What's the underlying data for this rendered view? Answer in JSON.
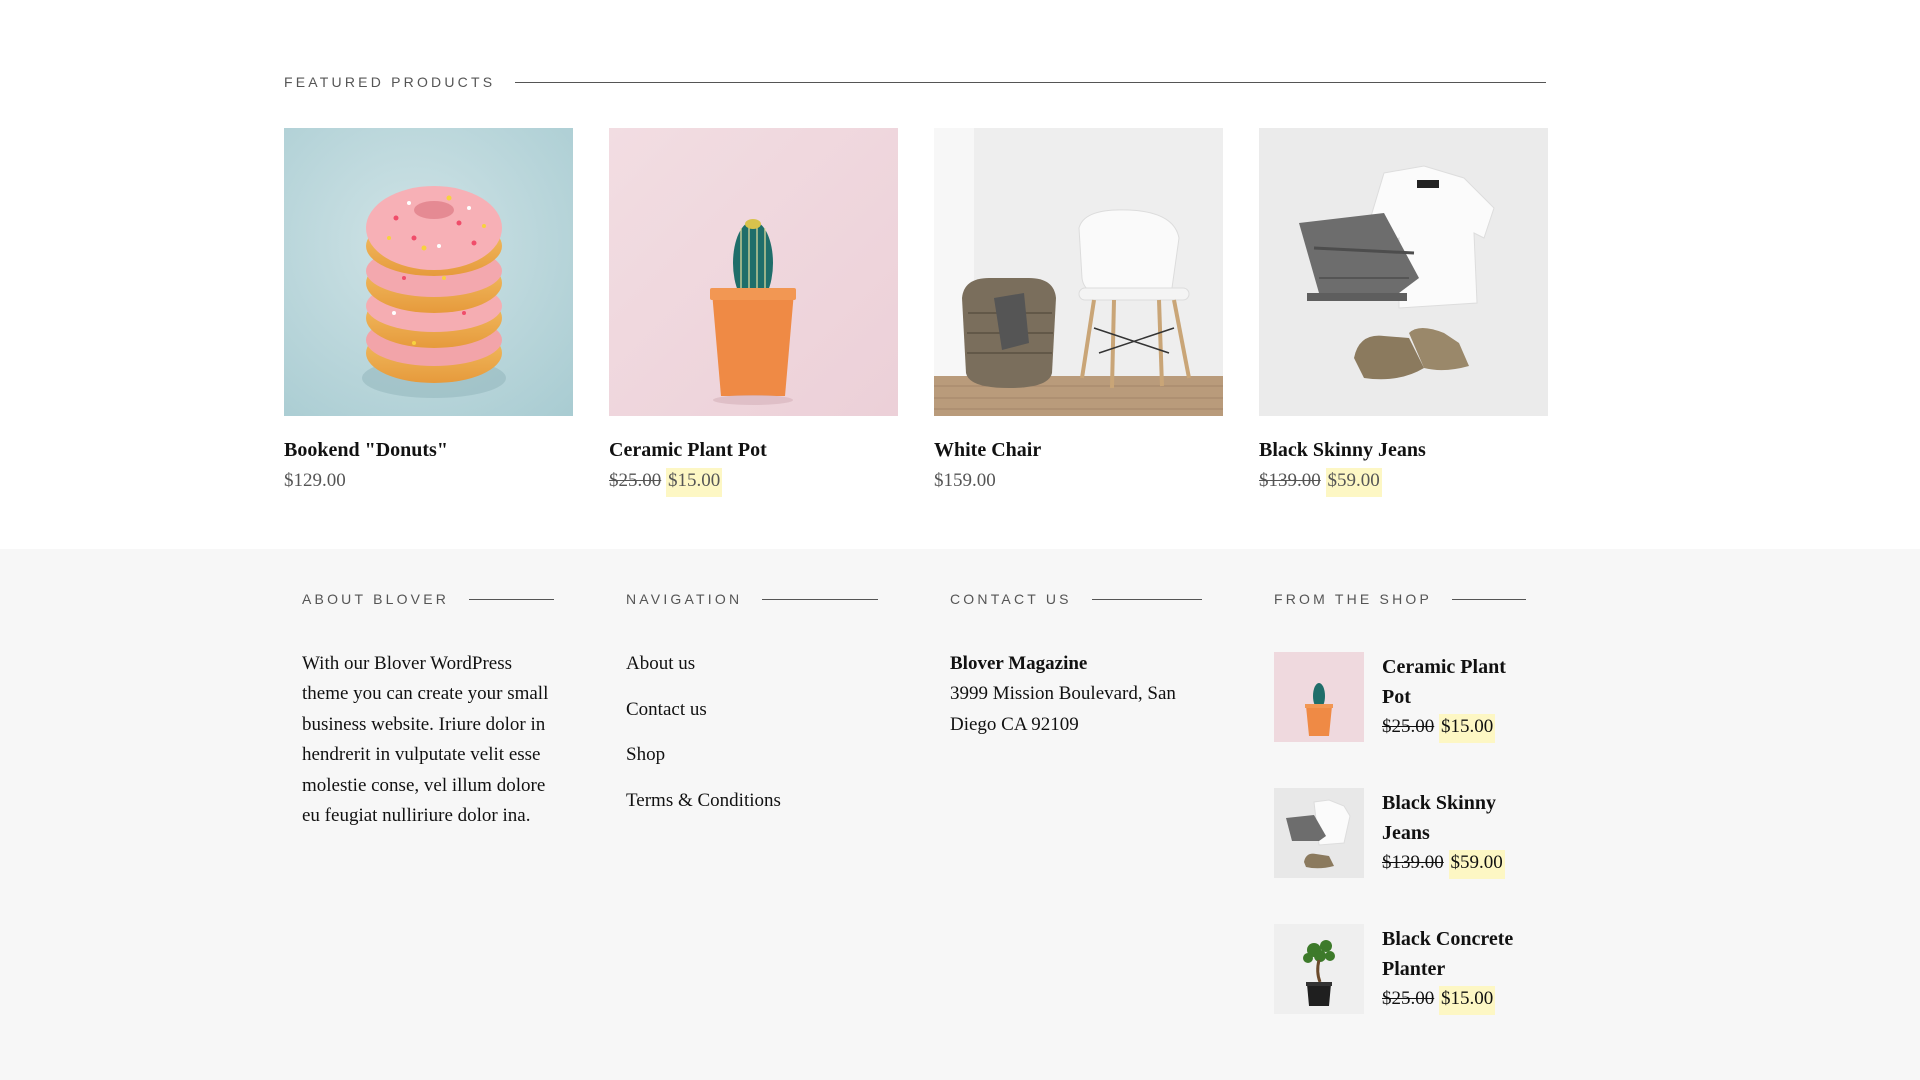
{
  "featured": {
    "heading": "FEATURED PRODUCTS",
    "products": [
      {
        "name": "Bookend \"Donuts\"",
        "price": "$129.00",
        "image": "donuts-stack"
      },
      {
        "name": "Ceramic Plant Pot",
        "old_price": "$25.00",
        "sale_price": "$15.00",
        "image": "cactus-pot"
      },
      {
        "name": "White Chair",
        "price": "$159.00",
        "image": "white-chair-basket"
      },
      {
        "name": "Black Skinny Jeans",
        "old_price": "$139.00",
        "sale_price": "$59.00",
        "image": "clothes-flatlay"
      }
    ]
  },
  "footer": {
    "about": {
      "heading": "ABOUT BLOVER",
      "text": "With our Blover WordPress theme you can create your small business website. Iriure dolor in hendrerit in vulputate velit esse molestie conse, vel illum dolore eu feugiat nulliriure dolor ina."
    },
    "navigation": {
      "heading": "NAVIGATION",
      "links": [
        "About us",
        "Contact us",
        "Shop",
        "Terms & Conditions"
      ]
    },
    "contact": {
      "heading": "CONTACT US",
      "name": "Blover Magazine",
      "address": "3999 Mission Boulevard, San Diego CA 92109"
    },
    "shop": {
      "heading": "FROM THE SHOP",
      "items": [
        {
          "name": "Ceramic Plant Pot",
          "old_price": "$25.00",
          "sale_price": "$15.00",
          "image": "cactus-pot"
        },
        {
          "name": "Black Skinny Jeans",
          "old_price": "$139.00",
          "sale_price": "$59.00",
          "image": "clothes-flatlay"
        },
        {
          "name": "Black Concrete Planter",
          "old_price": "$25.00",
          "sale_price": "$15.00",
          "image": "bonsai-planter"
        }
      ]
    }
  },
  "colors": {
    "sale_highlight": "#fdf7c4",
    "footer_bg": "#f7f7f7",
    "muted_text": "#555555"
  }
}
